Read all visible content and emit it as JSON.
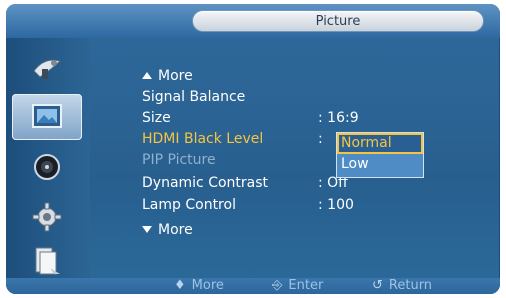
{
  "header": {
    "title": "Picture"
  },
  "sidebar": {
    "items": [
      {
        "icon": "satellite-dish-icon",
        "active": false
      },
      {
        "icon": "picture-icon",
        "active": true
      },
      {
        "icon": "speaker-icon",
        "active": false
      },
      {
        "icon": "gear-icon",
        "active": false
      },
      {
        "icon": "document-icon",
        "active": false
      }
    ]
  },
  "menu": {
    "more_up": "More",
    "items": [
      {
        "label": "Signal Balance",
        "value": ""
      },
      {
        "label": "Size",
        "value": ": 16:9"
      },
      {
        "label": "HDMI Black Level",
        "value": ":"
      },
      {
        "label": "PIP Picture",
        "value": ""
      },
      {
        "label": "Dynamic Contrast",
        "value": ": Off"
      },
      {
        "label": "Lamp Control",
        "value": ": 100"
      }
    ],
    "more_down": "More"
  },
  "dropdown": {
    "options": [
      "Normal",
      "Low"
    ],
    "selected": "Normal"
  },
  "footer": {
    "more": "More",
    "enter": "Enter",
    "return": "Return"
  },
  "colors": {
    "highlight": "#f5c542",
    "panel": "#2f6a9c",
    "disabled": "#8fb1cf"
  }
}
